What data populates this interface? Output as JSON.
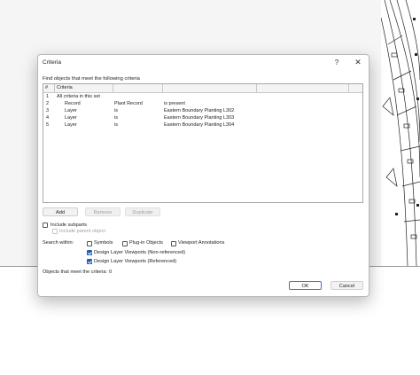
{
  "dialog": {
    "title": "Criteria",
    "help_glyph": "?",
    "close_glyph": "✕",
    "subtitle": "Find objects that meet the following criteria"
  },
  "table": {
    "headers": [
      "#",
      "Criteria",
      "",
      "",
      ""
    ],
    "rows": [
      {
        "num": "1",
        "c1": "All criteria in this set",
        "c2": "",
        "c3": "",
        "c4": ""
      },
      {
        "num": "2",
        "c1": "Record",
        "c2": "Plant Record",
        "c3": "is present",
        "c4": ""
      },
      {
        "num": "3",
        "c1": "Layer",
        "c2": "is",
        "c3": "Eastern Boundary Planting L302",
        "c4": ""
      },
      {
        "num": "4",
        "c1": "Layer",
        "c2": "is",
        "c3": "Eastern Boundary Planting L303",
        "c4": ""
      },
      {
        "num": "5",
        "c1": "Layer",
        "c2": "is",
        "c3": "Eastern Boundary Planting L304",
        "c4": ""
      }
    ]
  },
  "buttons": {
    "add": "Add",
    "remove": "Remove",
    "duplicate": "Duplicate",
    "ok": "OK",
    "cancel": "Cancel"
  },
  "options": {
    "include_subparts": {
      "label": "Include subparts",
      "checked": false
    },
    "include_parent": {
      "label": "Include parent object",
      "checked": false,
      "enabled": false
    }
  },
  "search_within": {
    "label": "Search within:",
    "symbols": {
      "label": "Symbols",
      "checked": false
    },
    "plugin_objects": {
      "label": "Plug-in Objects",
      "checked": false
    },
    "viewport_annotations": {
      "label": "Viewport Annotations",
      "checked": false
    },
    "dlv_non_referenced": {
      "label": "Design Layer Viewports (Non-referenced)",
      "checked": true
    },
    "dlv_referenced": {
      "label": "Design Layer Viewports (Referenced)",
      "checked": true
    }
  },
  "status": {
    "label": "Objects that meet the criteria:",
    "count": "0"
  }
}
